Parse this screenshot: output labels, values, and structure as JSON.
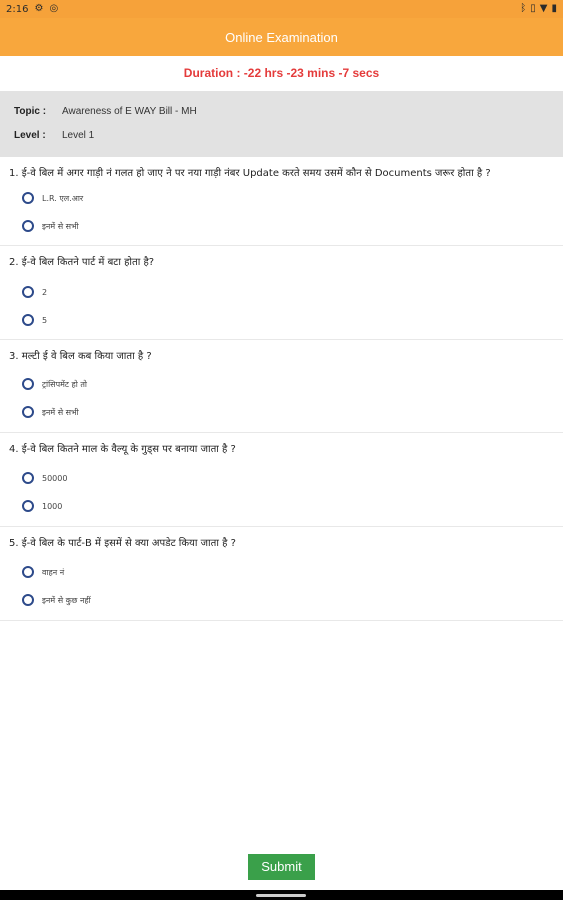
{
  "status_bar": {
    "time": "2:16",
    "icons": [
      "gear-icon",
      "data-saver-icon",
      "bluetooth-icon",
      "vibrate-icon",
      "wifi-icon",
      "battery-icon"
    ]
  },
  "app_bar": {
    "title": "Online Examination"
  },
  "duration": {
    "text": "Duration : -22 hrs -23 mins -7 secs"
  },
  "info": {
    "topic_label": "Topic :",
    "topic_value": "Awareness of E WAY Bill - MH",
    "level_label": "Level :",
    "level_value": "Level 1"
  },
  "questions": [
    {
      "text": "1.  ई-वे बिल में अगर गाड़ी नं गलत हो जाए ने पर नया गाड़ी नंबर Update करते समय उसमें कौन से Documents जरूर होता है ?",
      "options": [
        "L.R. एल.आर",
        "इनमें से सभी"
      ]
    },
    {
      "text": "2.  ई-वे बिल कितने पार्ट में बटा होता है?",
      "options": [
        "2",
        "5"
      ]
    },
    {
      "text": "3.  मल्टी ई वे बिल कब किया जाता है ?",
      "options": [
        "ट्रांसिपमेंट हो तो",
        "इनमें से सभी"
      ]
    },
    {
      "text": "4.  ई-वे बिल कितने माल के वैल्यू के गुड्स पर बनाया जाता है ?",
      "options": [
        "50000",
        "1000"
      ]
    },
    {
      "text": "5.  ई-वे बिल के पार्ट-B में इसमें से क्या अपडेट किया जाता है ?",
      "options": [
        "वाहन नं",
        "इनमें से कुछ नहीं"
      ]
    }
  ],
  "footer": {
    "submit_label": "Submit"
  }
}
